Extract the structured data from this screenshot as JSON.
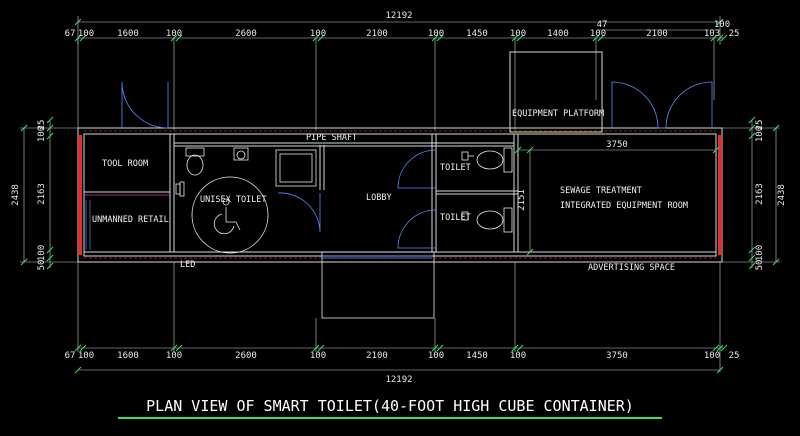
{
  "drawing": {
    "title": "PLAN VIEW OF SMART TOILET(40-FOOT HIGH CUBE CONTAINER)",
    "colors": {
      "background": "#000000",
      "wall": "#d8d8d8",
      "dimension_tick": "#2ee36b",
      "door": "#5b8cff",
      "column": "#e03030",
      "title_underline": "#2ee36b",
      "partition": "#c040c0"
    }
  },
  "dimensions": {
    "top_total": "12192",
    "top_offsets": [
      "47",
      "100"
    ],
    "top_row": [
      "67",
      "100",
      "1600",
      "100",
      "2600",
      "100",
      "2100",
      "100",
      "1450",
      "100",
      "1400",
      "100",
      "2100",
      "103",
      "25"
    ],
    "bottom_total": "12192",
    "bottom_row": [
      "67",
      "100",
      "1600",
      "100",
      "2600",
      "100",
      "2100",
      "100",
      "1450",
      "100",
      "3750",
      "100",
      "25"
    ],
    "room_3750": "3750",
    "room_2151": "2151",
    "left_outer": "2438",
    "left_inner": [
      "25",
      "100",
      "2163",
      "100",
      "50"
    ],
    "right_outer": "2438",
    "right_inner": [
      "25",
      "100",
      "2163",
      "100",
      "50"
    ]
  },
  "rooms": {
    "tool_room": "TOOL ROOM",
    "unmanned_retail": "UNMANNED RETAIL",
    "unisex_toilet": "UNISEX TOILET",
    "lobby": "LOBBY",
    "toilet_upper": "TOILET",
    "toilet_lower": "TOILET",
    "pipe_shaft": "PIPE SHAFT",
    "equipment_platform": "EQUIPMENT PLATFORM",
    "sewage_line1": "SEWAGE TREATMENT",
    "sewage_line2": "INTEGRATED EQUIPMENT ROOM",
    "led": "LED",
    "advertising_space": "ADVERTISING SPACE"
  }
}
